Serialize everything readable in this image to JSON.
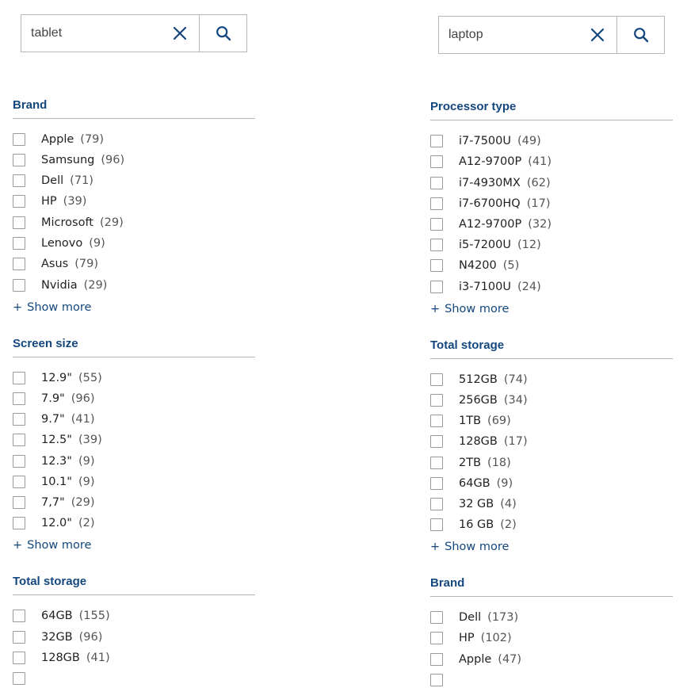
{
  "left": {
    "search": {
      "value": "tablet",
      "clear_icon": "close-icon",
      "submit_icon": "search-icon"
    },
    "facets": [
      {
        "title": "Brand",
        "show_more": "Show more",
        "options": [
          {
            "label": "Apple",
            "count": "(79)"
          },
          {
            "label": "Samsung",
            "count": "(96)"
          },
          {
            "label": "Dell",
            "count": "(71)"
          },
          {
            "label": "HP",
            "count": "(39)"
          },
          {
            "label": "Microsoft",
            "count": "(29)"
          },
          {
            "label": "Lenovo",
            "count": "(9)"
          },
          {
            "label": "Asus",
            "count": "(79)"
          },
          {
            "label": "Nvidia",
            "count": "(29)"
          }
        ]
      },
      {
        "title": "Screen size",
        "show_more": "Show more",
        "options": [
          {
            "label": "12.9\"",
            "count": "(55)"
          },
          {
            "label": "7.9\"",
            "count": "(96)"
          },
          {
            "label": "9.7\"",
            "count": "(41)"
          },
          {
            "label": "12.5\"",
            "count": "(39)"
          },
          {
            "label": "12.3\"",
            "count": "(9)"
          },
          {
            "label": "10.1\"",
            "count": "(9)"
          },
          {
            "label": "7,7\"",
            "count": "(29)"
          },
          {
            "label": "12.0\"",
            "count": "(2)"
          }
        ]
      },
      {
        "title": "Total storage",
        "show_more": "",
        "options": [
          {
            "label": "64GB",
            "count": "(155)"
          },
          {
            "label": "32GB",
            "count": "(96)"
          },
          {
            "label": "128GB",
            "count": "(41)"
          },
          {
            "label": "",
            "count": ""
          }
        ]
      }
    ]
  },
  "right": {
    "search": {
      "value": "laptop",
      "clear_icon": "close-icon",
      "submit_icon": "search-icon"
    },
    "facets": [
      {
        "title": "Processor type",
        "show_more": "Show more",
        "options": [
          {
            "label": "i7-7500U",
            "count": "(49)"
          },
          {
            "label": "A12-9700P",
            "count": "(41)"
          },
          {
            "label": "i7-4930MX",
            "count": "(62)"
          },
          {
            "label": "i7-6700HQ",
            "count": "(17)"
          },
          {
            "label": "A12-9700P",
            "count": "(32)"
          },
          {
            "label": "i5-7200U",
            "count": "(12)"
          },
          {
            "label": "N4200",
            "count": "(5)"
          },
          {
            "label": "i3-7100U",
            "count": "(24)"
          }
        ]
      },
      {
        "title": "Total storage",
        "show_more": "Show more",
        "options": [
          {
            "label": "512GB",
            "count": "(74)"
          },
          {
            "label": "256GB",
            "count": "(34)"
          },
          {
            "label": "1TB",
            "count": "(69)"
          },
          {
            "label": "128GB",
            "count": "(17)"
          },
          {
            "label": "2TB",
            "count": "(18)"
          },
          {
            "label": "64GB",
            "count": "(9)"
          },
          {
            "label": "32 GB",
            "count": "(4)"
          },
          {
            "label": "16 GB",
            "count": "(2)"
          }
        ]
      },
      {
        "title": "Brand",
        "show_more": "",
        "options": [
          {
            "label": "Dell",
            "count": "(173)"
          },
          {
            "label": "HP",
            "count": "(102)"
          },
          {
            "label": "Apple",
            "count": "(47)"
          },
          {
            "label": "",
            "count": ""
          }
        ]
      }
    ]
  },
  "colors": {
    "accent": "#14477d",
    "border": "#b7b7b7"
  }
}
